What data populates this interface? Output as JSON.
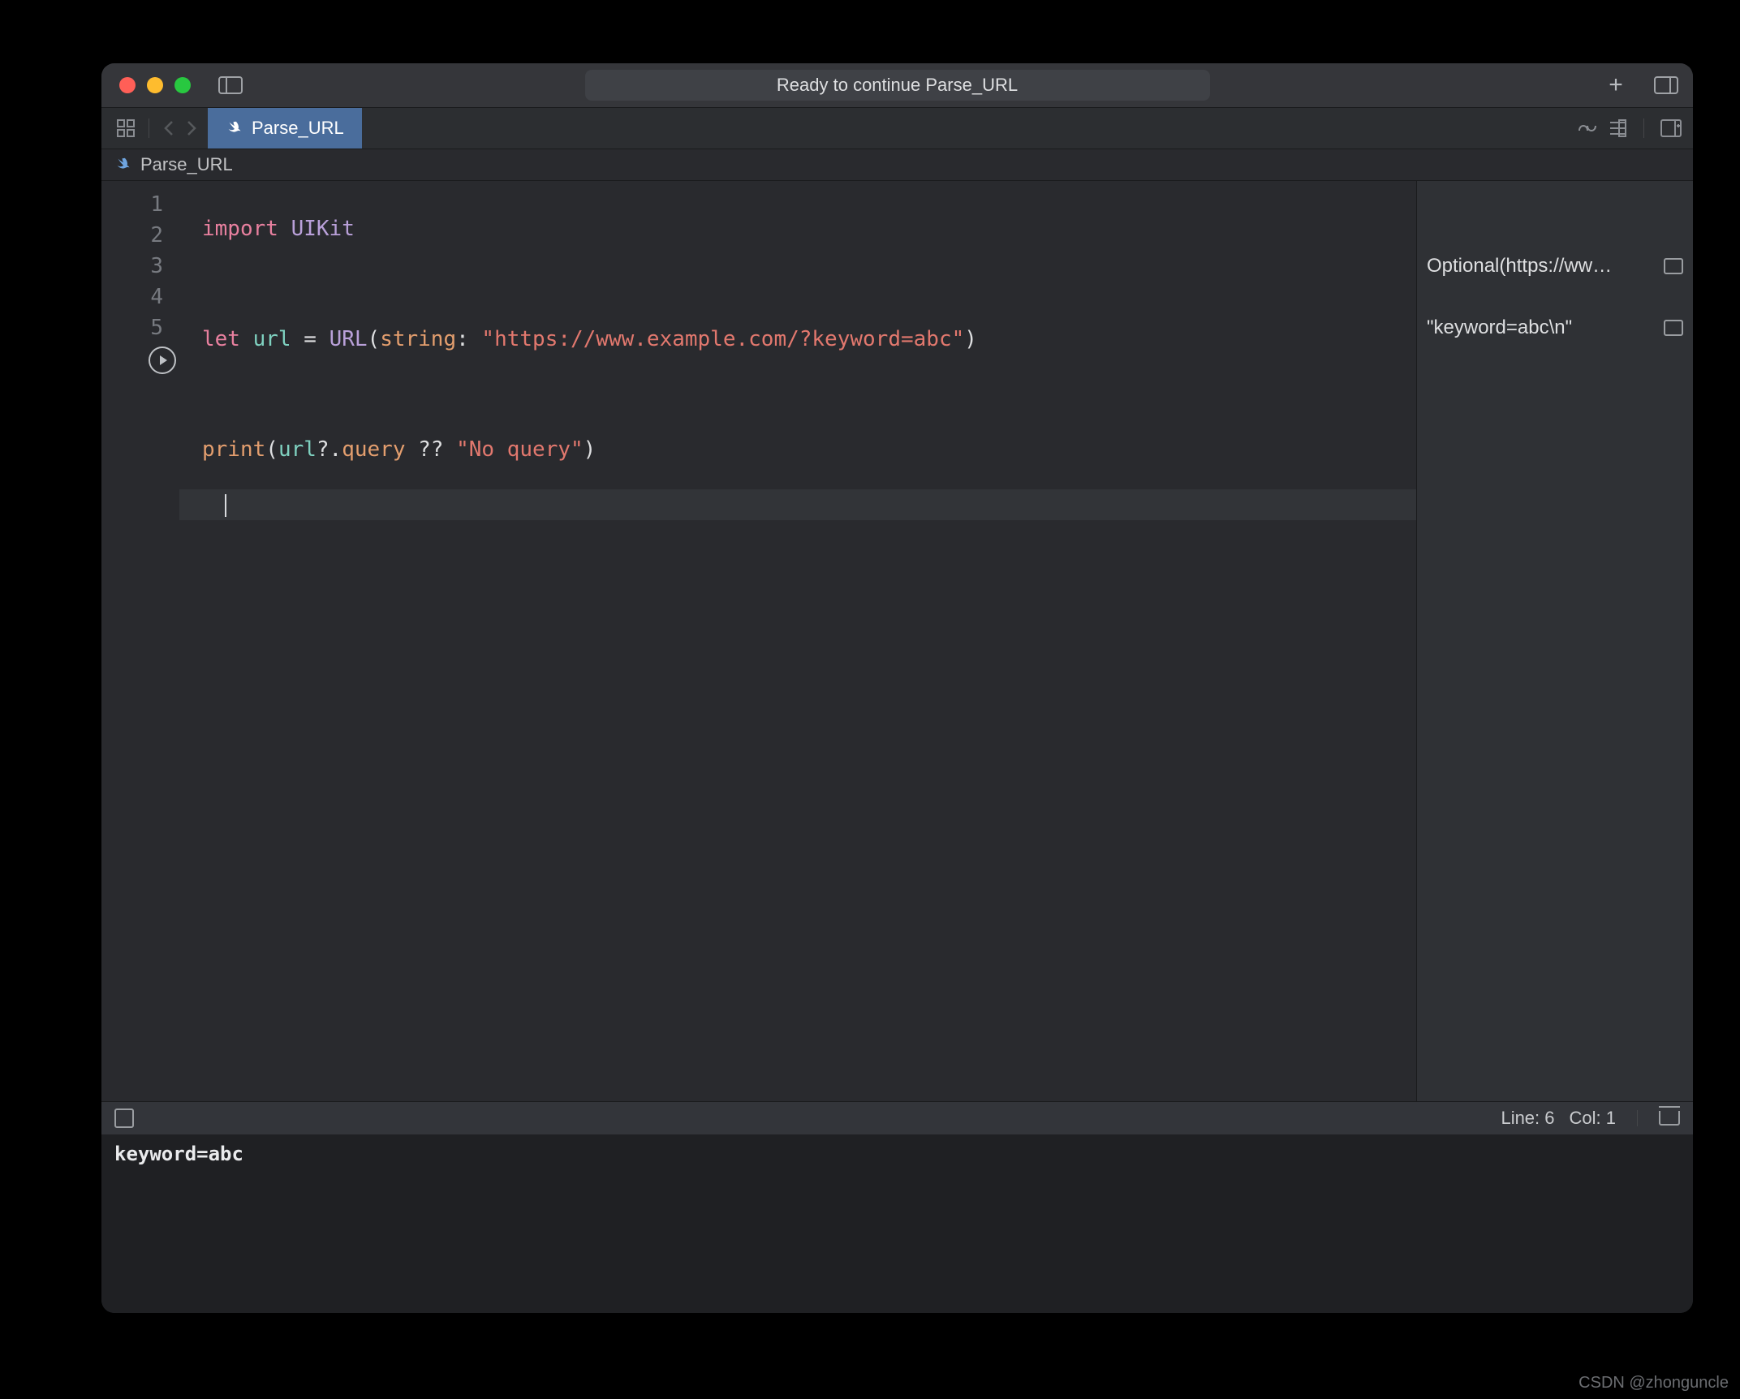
{
  "title": "Ready to continue Parse_URL",
  "tab_label": "Parse_URL",
  "breadcrumb_label": "Parse_URL",
  "code": {
    "line_numbers": [
      "1",
      "2",
      "3",
      "4",
      "5"
    ],
    "t_import": "import",
    "t_uikit": "UIKit",
    "t_let": "let",
    "t_url_id": "url",
    "t_eq": " = ",
    "t_url_type": "URL",
    "t_lparen": "(",
    "t_string_lbl": "string",
    "t_colon": ": ",
    "t_url_str": "\"https://www.example.com/?keyword=abc\"",
    "t_rparen": ")",
    "t_print": "print",
    "t_url_id2": "url",
    "t_opt": "?.",
    "t_query": "query",
    "t_nc": " ?? ",
    "t_noq": "\"No query\"",
    "t_rparen2": ")"
  },
  "results": {
    "r3": "Optional(https://ww…",
    "r5": "\"keyword=abc\\n\""
  },
  "status": {
    "line": "Line: 6",
    "col": "Col: 1"
  },
  "console": "keyword=abc",
  "watermark": "CSDN @zhonguncle"
}
